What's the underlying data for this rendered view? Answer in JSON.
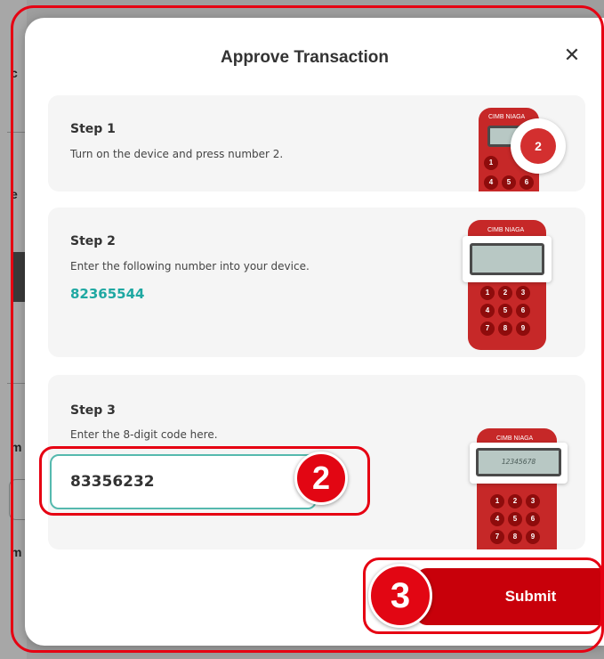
{
  "background": {
    "fragments": [
      "c",
      "e",
      "J",
      "m",
      "m"
    ]
  },
  "modal": {
    "title": "Approve Transaction",
    "close_icon": "close-icon",
    "steps": [
      {
        "title": "Step 1",
        "description": "Turn on the device and press number 2.",
        "device_badge": "2"
      },
      {
        "title": "Step 2",
        "description": "Enter the following number into your device.",
        "number": "82365544"
      },
      {
        "title": "Step 3",
        "description": "Enter the 8-digit code here.",
        "input_value": "83356232",
        "device_screen": "12345678"
      }
    ],
    "submit_label": "Submit"
  },
  "device": {
    "brand": "CIMB NIAGA",
    "keys_step1": [
      "1",
      "4",
      "5",
      "6"
    ],
    "keys": [
      "1",
      "2",
      "3",
      "4",
      "5",
      "6",
      "7",
      "8",
      "9"
    ]
  },
  "annotations": {
    "badge_input": "2",
    "badge_submit": "3"
  },
  "colors": {
    "accent_red": "#c8000a",
    "annotation_red": "#e60012",
    "teal": "#1fa8a2",
    "input_border": "#55b9ae"
  }
}
